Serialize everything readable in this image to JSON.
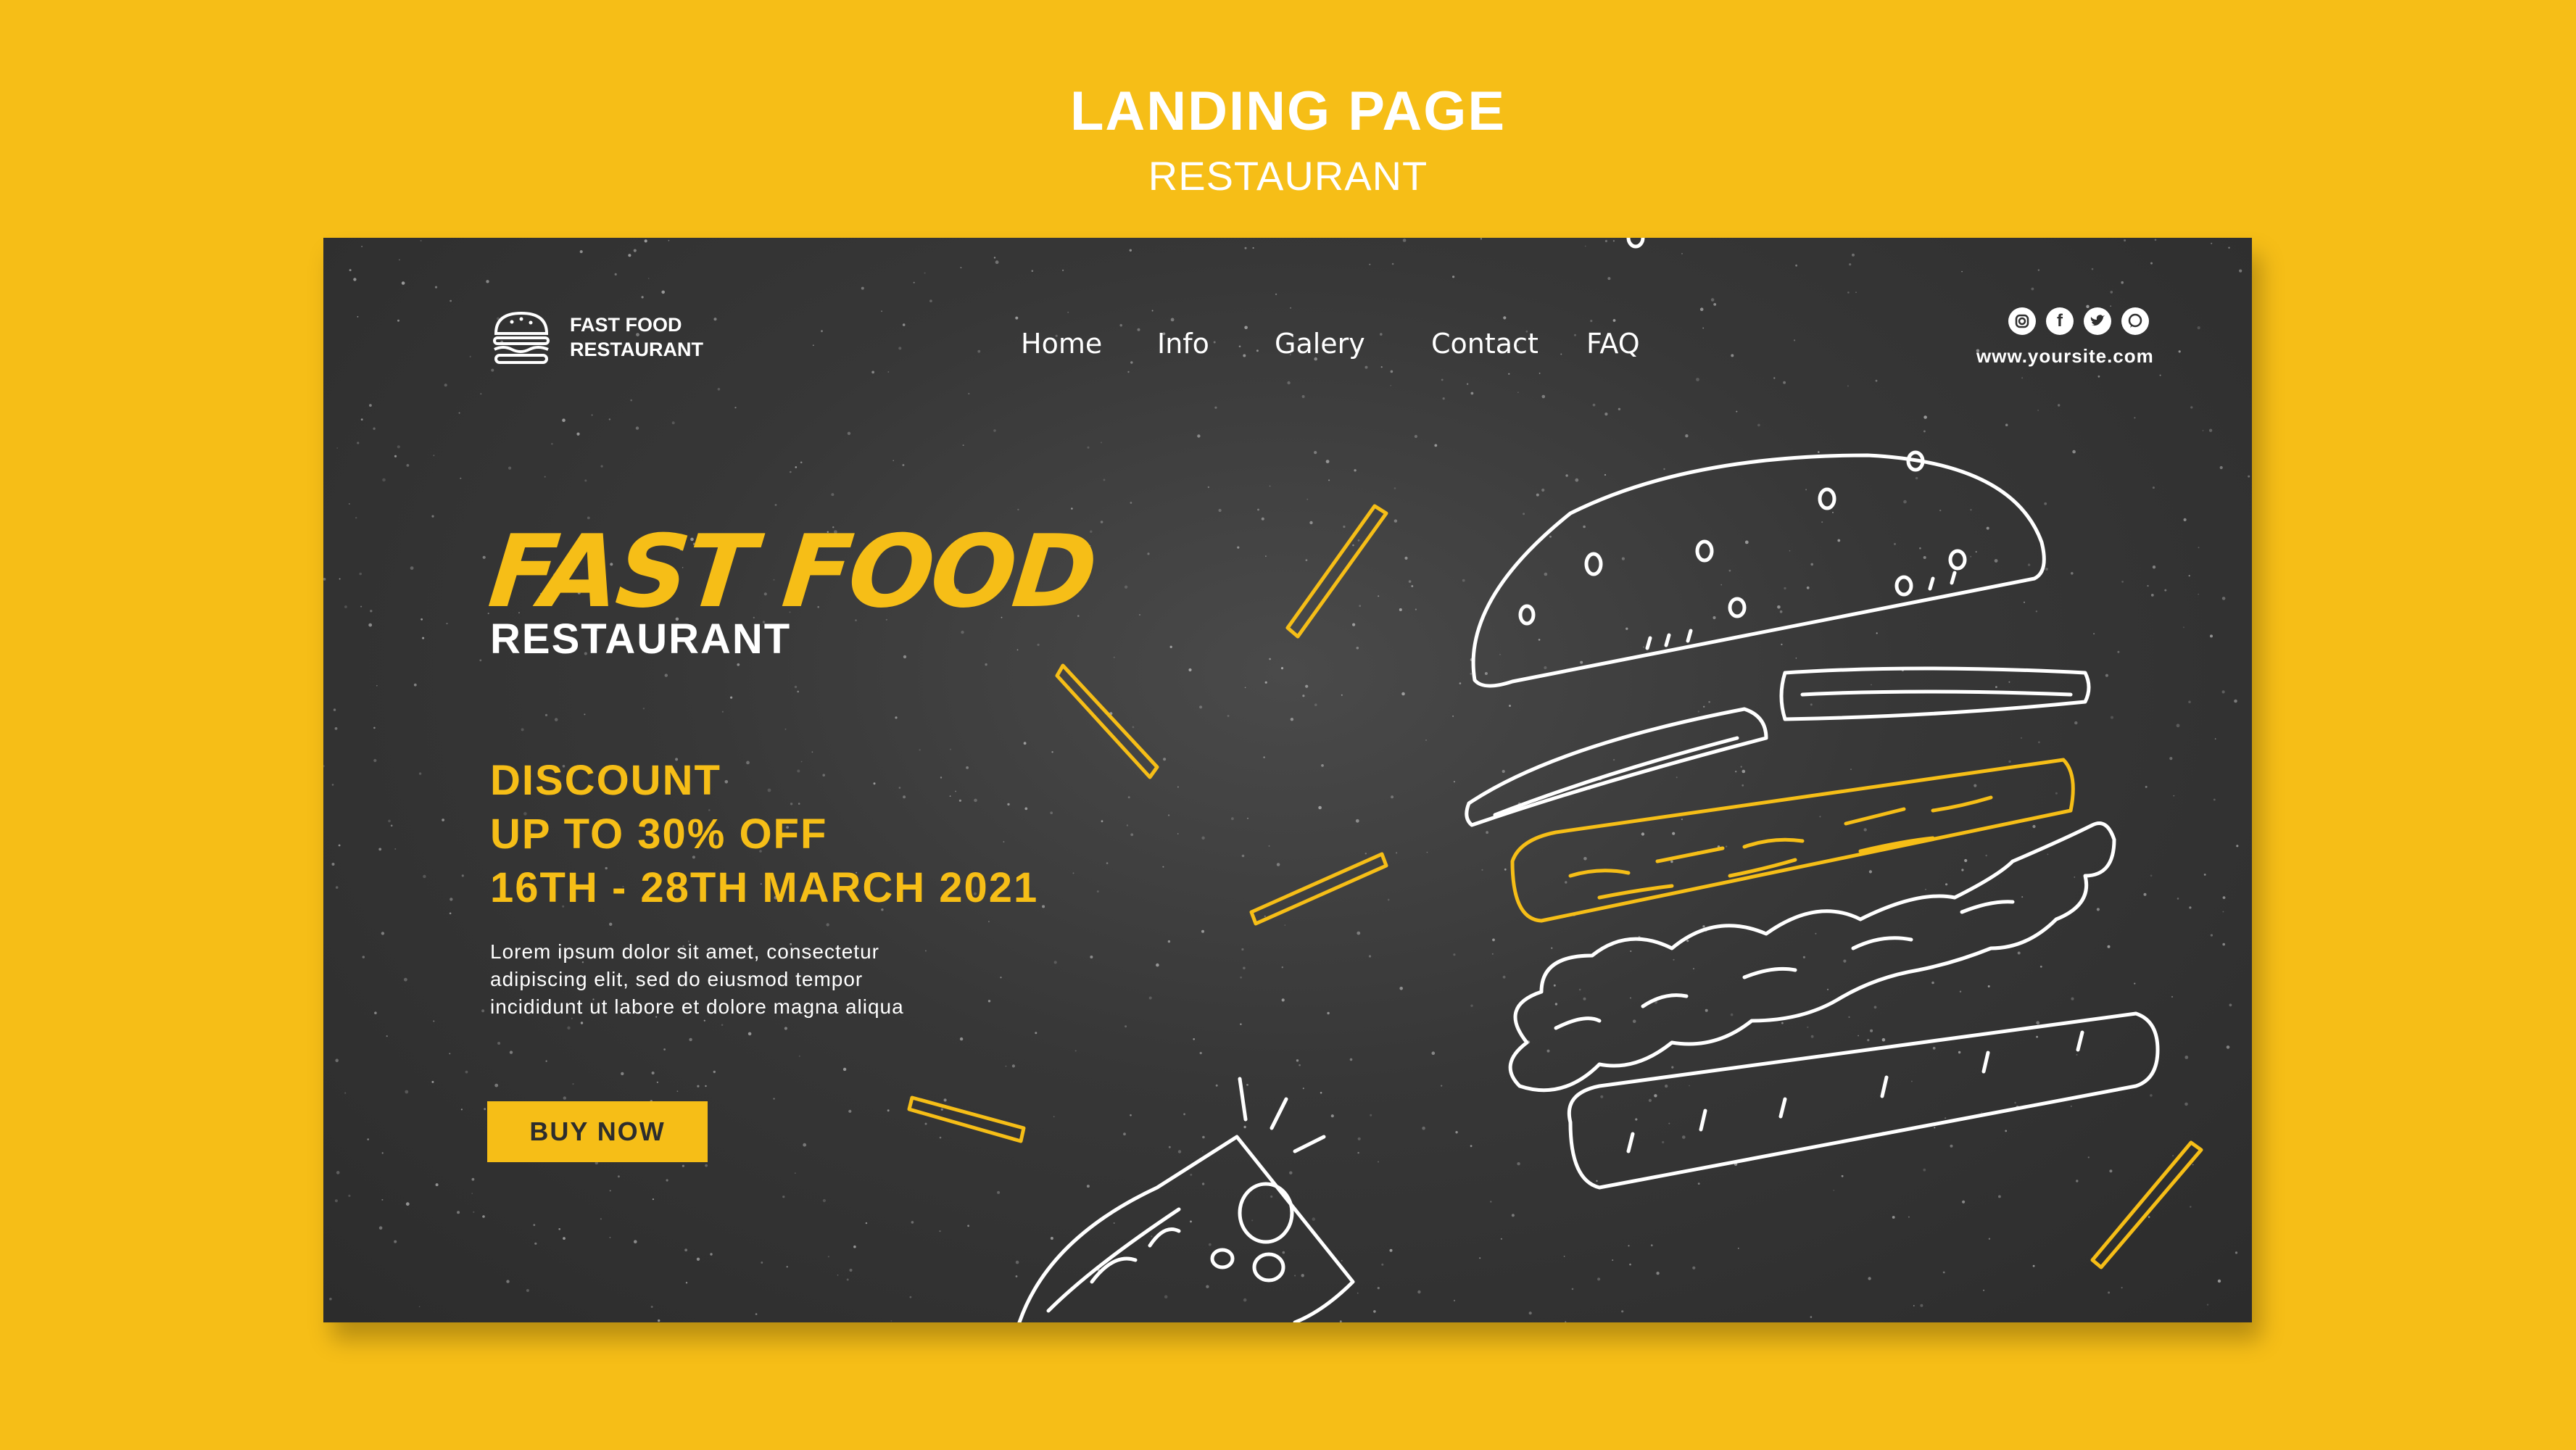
{
  "header": {
    "title": "LANDING PAGE",
    "subtitle": "RESTAURANT"
  },
  "logo": {
    "line1": "FAST FOOD",
    "line2": "RESTAURANT",
    "icon": "burger-icon"
  },
  "nav": {
    "items": [
      "Home",
      "Info",
      "Galery",
      "Contact",
      "FAQ"
    ]
  },
  "socials": {
    "icons": [
      "instagram-icon",
      "facebook-icon",
      "twitter-icon",
      "whatsapp-icon"
    ],
    "url": "www.yoursite.com"
  },
  "hero": {
    "title": "FAST FOOD",
    "subtitle": "RESTAURANT"
  },
  "discount": {
    "line1": "DISCOUNT",
    "line2": "UP TO 30% OFF",
    "line3": "16TH - 28TH MARCH 2021"
  },
  "description": {
    "line1": "Lorem ipsum dolor sit amet, consectetur",
    "line2": "adipiscing elit, sed do eiusmod tempor",
    "line3": "incididunt ut labore et dolore magna aliqua"
  },
  "cta": {
    "label": "BUY NOW"
  },
  "colors": {
    "accent": "#f6be17",
    "board": "#333333",
    "text": "#ffffff"
  }
}
